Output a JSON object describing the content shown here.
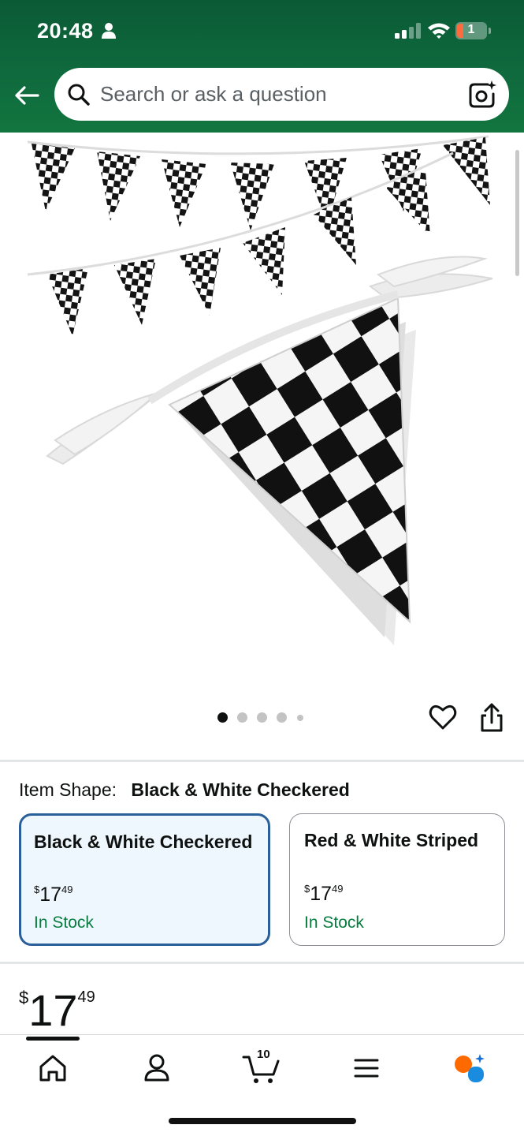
{
  "status_bar": {
    "time": "20:48",
    "battery": "1"
  },
  "search": {
    "placeholder": "Search or ask a question"
  },
  "gallery": {
    "total_images": 5,
    "active_index": 0
  },
  "item_shape": {
    "label": "Item Shape:",
    "value": "Black & White Checkered"
  },
  "options": [
    {
      "name": "Black & White Checkered",
      "currency": "$",
      "whole": "17",
      "cents": "49",
      "stock": "In Stock",
      "selected": true
    },
    {
      "name": "Red & White Striped",
      "currency": "$",
      "whole": "17",
      "cents": "49",
      "stock": "In Stock",
      "selected": false
    }
  ],
  "price": {
    "currency": "$",
    "whole": "17",
    "cents": "49"
  },
  "bottom_nav": {
    "items": [
      "home-icon",
      "account-icon",
      "cart-icon",
      "menu-icon",
      "rufus-icon"
    ],
    "cart_count": "10"
  },
  "colors": {
    "header_green": "#0f6a3d",
    "in_stock": "#067d3e",
    "selected_border": "#2b5f99",
    "selected_bg": "#edf7fd"
  }
}
